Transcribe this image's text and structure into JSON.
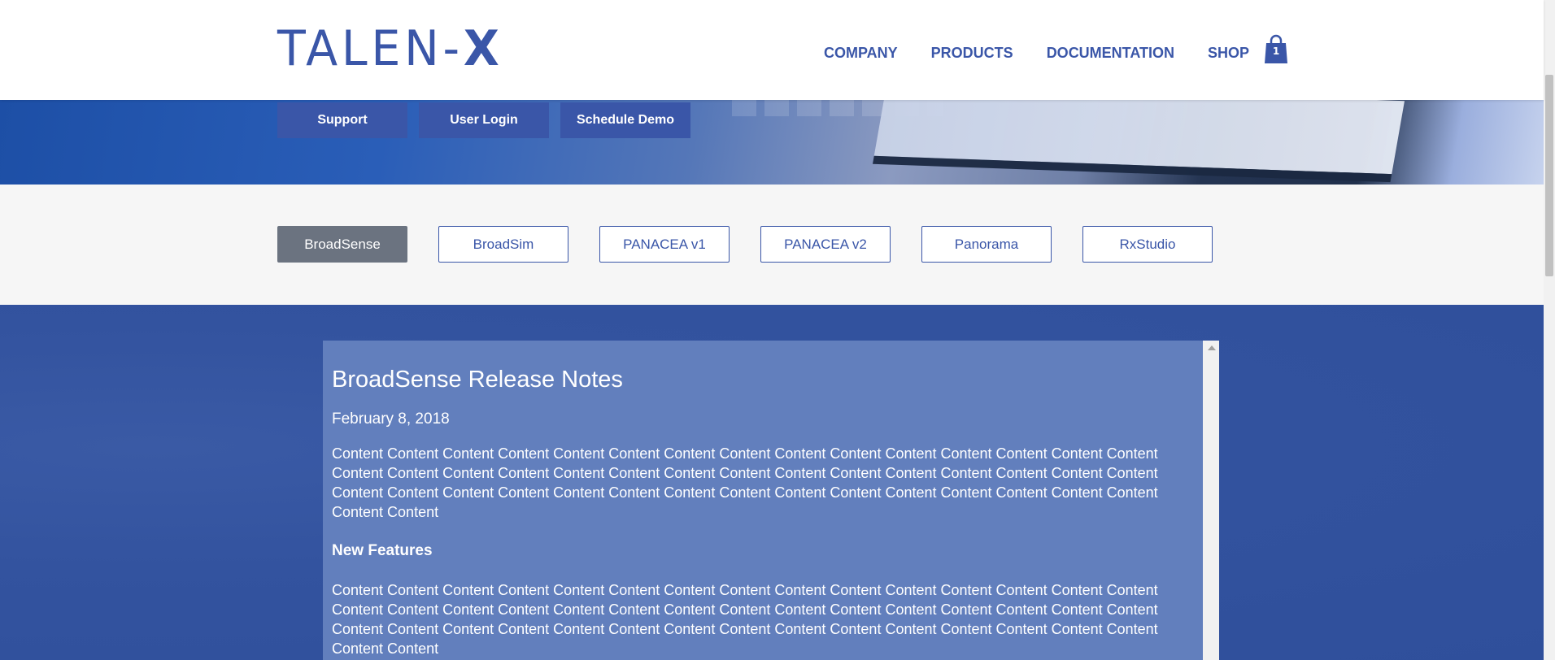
{
  "header": {
    "logo_main": "TALEN-",
    "logo_x": "X",
    "nav": [
      "COMPANY",
      "PRODUCTS",
      "DOCUMENTATION",
      "SHOP"
    ],
    "cart_count": "1"
  },
  "hero": {
    "buttons": [
      "Support",
      "User Login",
      "Schedule Demo"
    ]
  },
  "tabs": {
    "items": [
      "BroadSense",
      "BroadSim",
      "PANACEA v1",
      "PANACEA v2",
      "Panorama",
      "RxStudio"
    ],
    "active": "BroadSense"
  },
  "release": {
    "title": "BroadSense Release Notes",
    "date": "February 8, 2018",
    "paragraph1": "Content Content Content Content Content Content Content Content Content Content Content Content Content Content Content Content Content Content Content Content Content Content Content Content Content Content Content Content Content Content Content Content Content Content Content Content Content Content Content Content Content Content Content Content Content Content Content",
    "section_heading": "New Features",
    "paragraph2": "Content Content Content Content Content Content Content Content Content Content Content Content Content Content Content Content Content Content Content Content Content Content Content Content Content Content Content Content Content Content Content Content Content Content Content Content Content Content Content Content Content Content Content Content Content Content Content"
  },
  "colors": {
    "brand": "#3a56a8",
    "active_tab": "#6b7380",
    "panel": "#627fbd"
  }
}
